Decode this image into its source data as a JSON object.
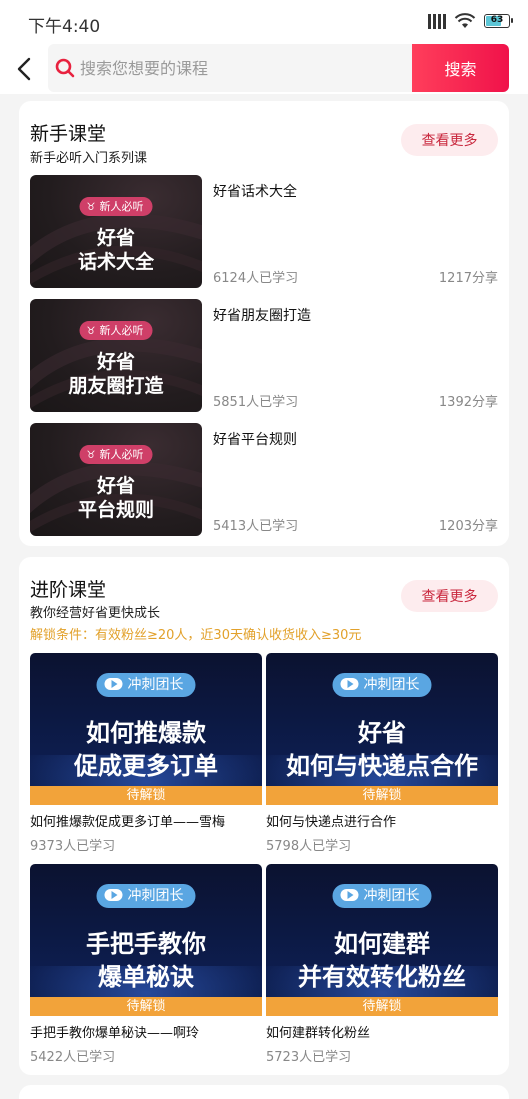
{
  "status": {
    "time": "下午4:40",
    "battery": "63"
  },
  "search": {
    "placeholder": "搜索您想要的课程",
    "button": "搜索"
  },
  "beginner": {
    "title": "新手课堂",
    "subtitle": "新手必听入门系列课",
    "more": "查看更多",
    "badge": "新人必听",
    "courses": [
      {
        "line1": "好省",
        "line2": "话术大全",
        "title": "好省话术大全",
        "learners": "6124人已学习",
        "shares": "1217分享"
      },
      {
        "line1": "好省",
        "line2": "朋友圈打造",
        "title": "好省朋友圈打造",
        "learners": "5851人已学习",
        "shares": "1392分享"
      },
      {
        "line1": "好省",
        "line2": "平台规则",
        "title": "好省平台规则",
        "learners": "5413人已学习",
        "shares": "1203分享"
      }
    ]
  },
  "advanced": {
    "title": "进阶课堂",
    "subtitle": "教你经营好省更快成长",
    "unlock_condition": "解锁条件：有效粉丝≥20人，近30天确认收货收入≥30元",
    "more": "查看更多",
    "badge": "冲刺团长",
    "lock_label": "待解锁",
    "courses": [
      {
        "line1": "如何推爆款",
        "line2": "促成更多订单",
        "title": "如何推爆款促成更多订单——雪梅",
        "learners": "9373人已学习"
      },
      {
        "line1": "好省",
        "line2": "如何与快递点合作",
        "title": "如何与快递点进行合作",
        "learners": "5798人已学习"
      },
      {
        "line1": "手把手教你",
        "line2": "爆单秘诀",
        "title": "手把手教你爆单秘诀——啊玲",
        "learners": "5422人已学习"
      },
      {
        "line1": "如何建群",
        "line2": "并有效转化粉丝",
        "title": "如何建群转化粉丝",
        "learners": "5723人已学习"
      }
    ]
  }
}
